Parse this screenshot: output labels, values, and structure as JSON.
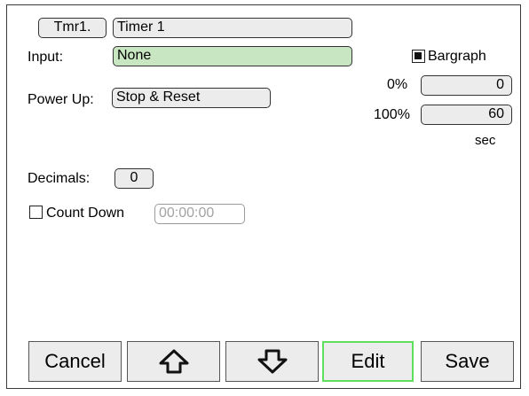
{
  "header": {
    "tag_button": "Tmr1.",
    "name_value": "Timer 1"
  },
  "input": {
    "label": "Input:",
    "value": "None"
  },
  "power_up": {
    "label": "Power Up:",
    "value": "Stop & Reset"
  },
  "bargraph": {
    "checkbox_label": "Bargraph",
    "checked": true,
    "min_label": "0%",
    "min_value": "0",
    "max_label": "100%",
    "max_value": "60",
    "unit": "sec"
  },
  "decimals": {
    "label": "Decimals:",
    "value": "0"
  },
  "count_down": {
    "label": "Count Down",
    "checked": false,
    "placeholder": "00:00:00"
  },
  "footer": {
    "cancel_label": "Cancel",
    "up_icon": "arrow-up-outline-icon",
    "down_icon": "arrow-down-outline-icon",
    "edit_label": "Edit",
    "save_label": "Save",
    "edit_highlight_color": "#5ee05e"
  },
  "colors": {
    "field_bg": "#ececec",
    "input_field_bg": "#c9e6c2"
  }
}
